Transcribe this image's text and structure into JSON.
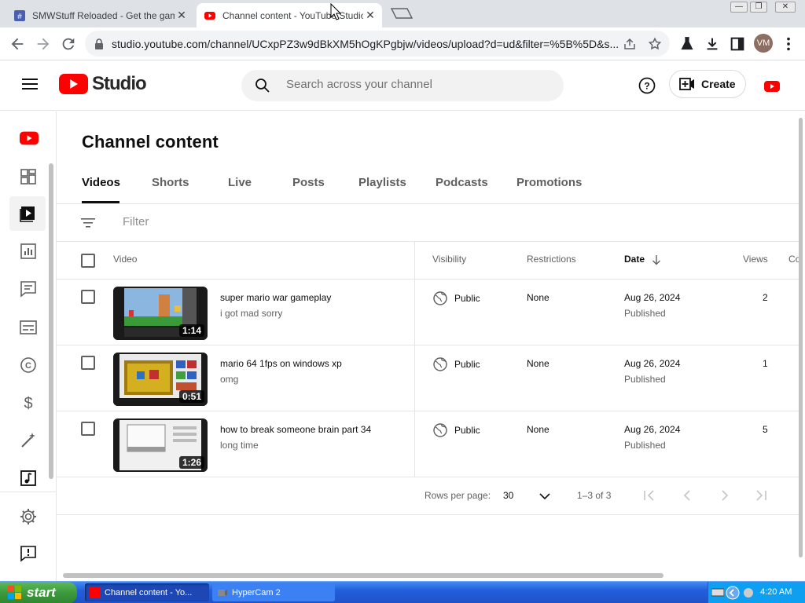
{
  "browser": {
    "tabs": [
      {
        "title": "SMWStuff Reloaded - Get the game"
      },
      {
        "title": "Channel content - YouTube Studio"
      }
    ],
    "url": "studio.youtube.com/channel/UCxpPZ3w9dBkXM5hOgKPgbjw/videos/upload?d=ud&filter=%5B%5D&s...",
    "avatar_initials": "VM"
  },
  "header": {
    "logo_text": "Studio",
    "search_placeholder": "Search across your channel",
    "create_label": "Create"
  },
  "main": {
    "title": "Channel content",
    "tabs": [
      "Videos",
      "Shorts",
      "Live",
      "Posts",
      "Playlists",
      "Podcasts",
      "Promotions"
    ],
    "filter_placeholder": "Filter",
    "columns": {
      "video": "Video",
      "visibility": "Visibility",
      "restrictions": "Restrictions",
      "date": "Date",
      "views": "Views",
      "comments": "Co"
    },
    "rows": [
      {
        "title": "super mario war gameplay",
        "description": "i got mad sorry",
        "duration": "1:14",
        "visibility": "Public",
        "restrictions": "None",
        "date": "Aug 26, 2024",
        "status": "Published",
        "views": "2"
      },
      {
        "title": "mario 64 1fps on windows xp",
        "description": "omg",
        "duration": "0:51",
        "visibility": "Public",
        "restrictions": "None",
        "date": "Aug 26, 2024",
        "status": "Published",
        "views": "1"
      },
      {
        "title": "how to break someone brain part 34",
        "description": "long time",
        "duration": "1:26",
        "visibility": "Public",
        "restrictions": "None",
        "date": "Aug 26, 2024",
        "status": "Published",
        "views": "5"
      }
    ],
    "pager": {
      "rows_label": "Rows per page:",
      "rows_value": "30",
      "range": "1–3 of 3"
    }
  },
  "taskbar": {
    "start_label": "start",
    "tasks": [
      "Channel content - Yo...",
      "HyperCam 2"
    ],
    "clock": "4:20 AM"
  },
  "colors": {
    "youtube_red": "#ff0000",
    "xp_taskbar": "#245edc",
    "xp_start": "#3c9a3c"
  }
}
